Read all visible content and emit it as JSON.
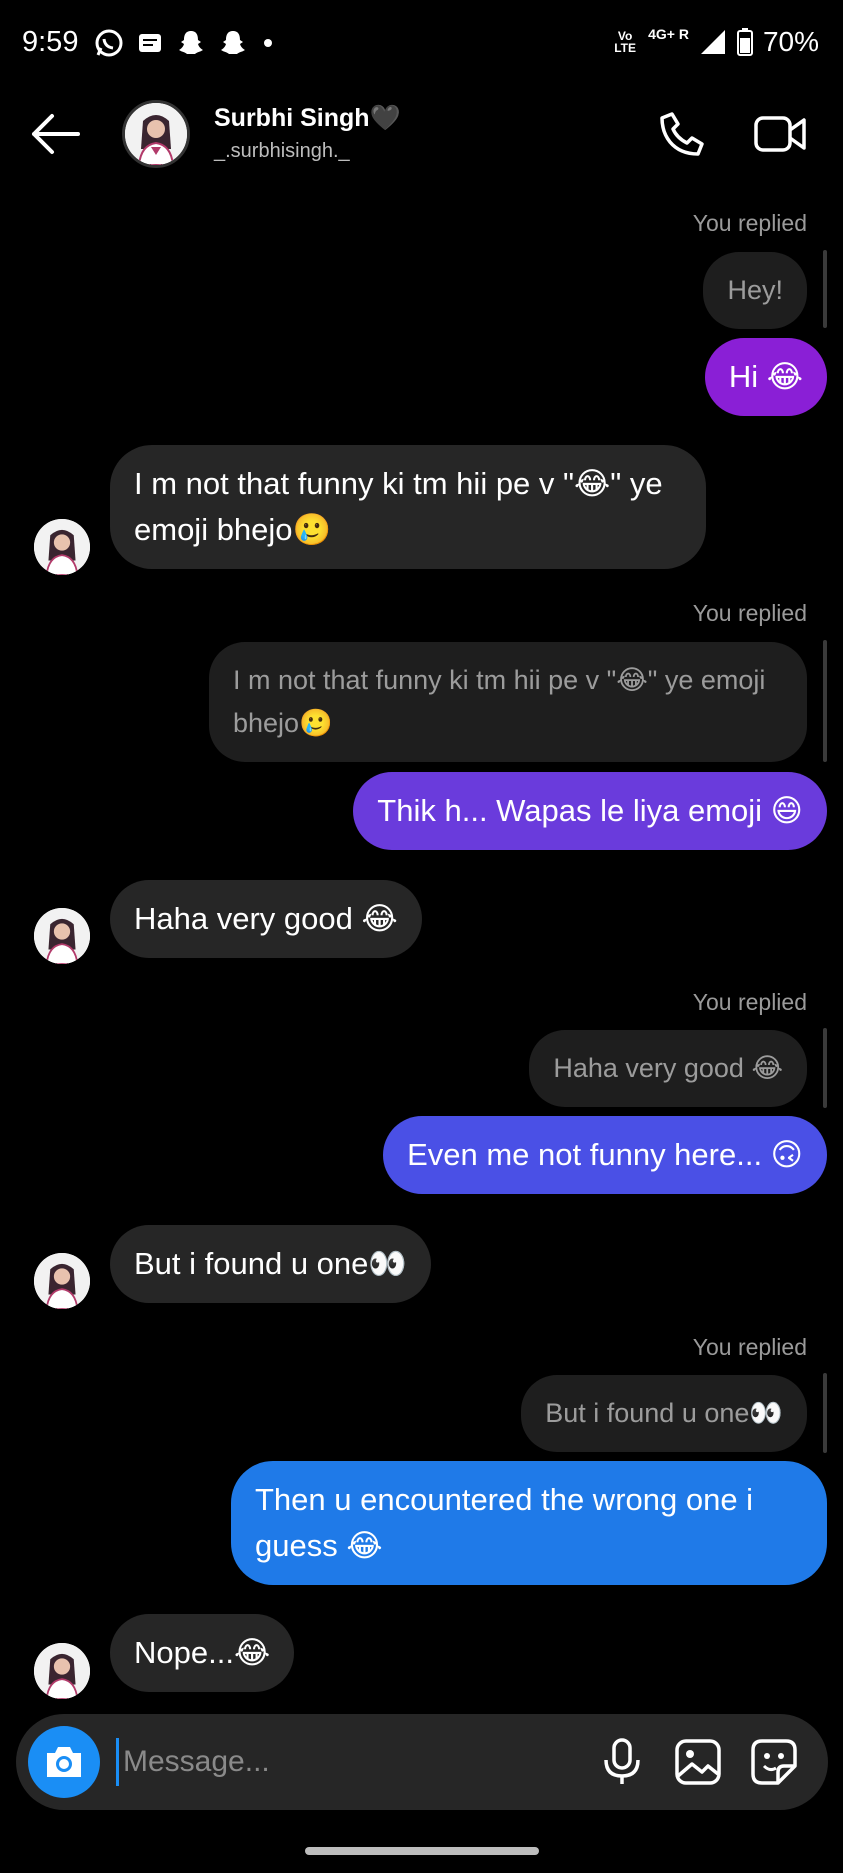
{
  "status": {
    "time": "9:59",
    "volte": "Vo LTE",
    "network": "4G+ R",
    "battery": "70%"
  },
  "header": {
    "name": "Surbhi Singh🖤",
    "username": "_.surbhisingh._"
  },
  "messages": {
    "m1_replied": "You replied",
    "m1_quote": "Hey!",
    "m2_out": "Hi 😂",
    "m3_in": "I m not that funny ki tm hii pe v \"😂\" ye emoji bhejo🥲",
    "m4_replied": "You replied",
    "m4_quote": "I m not that funny ki tm hii pe v \"😂\" ye emoji bhejo🥲",
    "m5_out": "Thik h... Wapas le liya emoji 😄",
    "m6_in": "Haha very good 😂",
    "m7_replied": "You replied",
    "m7_quote": "Haha very good 😂",
    "m8_out": "Even me not funny here... 🙃",
    "m9_in": "But i found u one👀",
    "m10_replied": "You replied",
    "m10_quote": "But i found u one👀",
    "m11_out": "Then u encountered the wrong one i guess 😂",
    "m12_in": "Nope...😂"
  },
  "composer": {
    "placeholder": "Message..."
  },
  "colors": {
    "bubble_purple": "#8a1fd6",
    "bubble_violet": "#6a3bdc",
    "bubble_indigo": "#4a50e6",
    "bubble_blue": "#1f7ae8",
    "incoming_bubble": "#262626",
    "accent": "#1a8ef5"
  }
}
